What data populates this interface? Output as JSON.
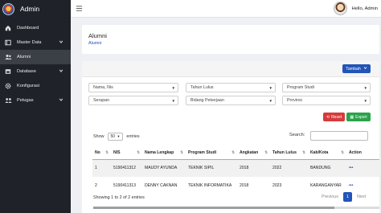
{
  "app": {
    "title": "Admin"
  },
  "topbar": {
    "user_label": "Hello, Admin"
  },
  "sidebar": {
    "items": [
      {
        "label": "Dashboard",
        "icon": "home-icon"
      },
      {
        "label": "Master Data",
        "icon": "folder-icon",
        "chevron": true
      },
      {
        "label": "Alumni",
        "icon": "users-icon",
        "active": true
      },
      {
        "label": "Database",
        "icon": "database-icon",
        "chevron": true
      },
      {
        "label": "Konfigurasi",
        "icon": "gear-icon"
      },
      {
        "label": "Petugas",
        "icon": "people-icon",
        "chevron": true
      }
    ]
  },
  "header": {
    "title": "Alumni",
    "breadcrumb": "Alumni"
  },
  "toolbar": {
    "add_label": "Tambah",
    "reset_label": "Reset",
    "export_label": "Export"
  },
  "filters": {
    "nama_nis": "Nama, Nis",
    "tahun_lulus": "Tahun Lulus",
    "program_studi": "Program Studi",
    "serapan": "Serapan",
    "bidang_pekerjaan": "Bidang Pekerjaan",
    "provinsi": "Provinsi"
  },
  "table": {
    "show_label": "Show",
    "entries_value": "50",
    "entries_label": "entries",
    "search_label": "Search:",
    "columns": [
      "No",
      "NIS",
      "Nama Lengkap",
      "Program Studi",
      "Angkatan",
      "Tahun Lulus",
      "Kab/Kota",
      "Action"
    ],
    "rows": [
      {
        "no": "1",
        "nis": "5190411312",
        "nama": "MAUDY AYUNDA",
        "prodi": "TEKNIK SIPIL",
        "angkatan": "2018",
        "lulus": "2022",
        "kota": "BANDUNG"
      },
      {
        "no": "2",
        "nis": "5190411313",
        "nama": "DENNY CAKNAN",
        "prodi": "TEKNIK INFORMATIKA",
        "angkatan": "2018",
        "lulus": "2023",
        "kota": "KARANGANYAR"
      }
    ],
    "info": "Showing 1 to 2 of 2 entries",
    "pager": {
      "previous": "Previous",
      "current": "1",
      "next": "Next"
    }
  },
  "colors": {
    "sidebar": "#1f2329",
    "primary": "#2255b8",
    "danger": "#d63b3b",
    "success": "#2aa34a"
  }
}
